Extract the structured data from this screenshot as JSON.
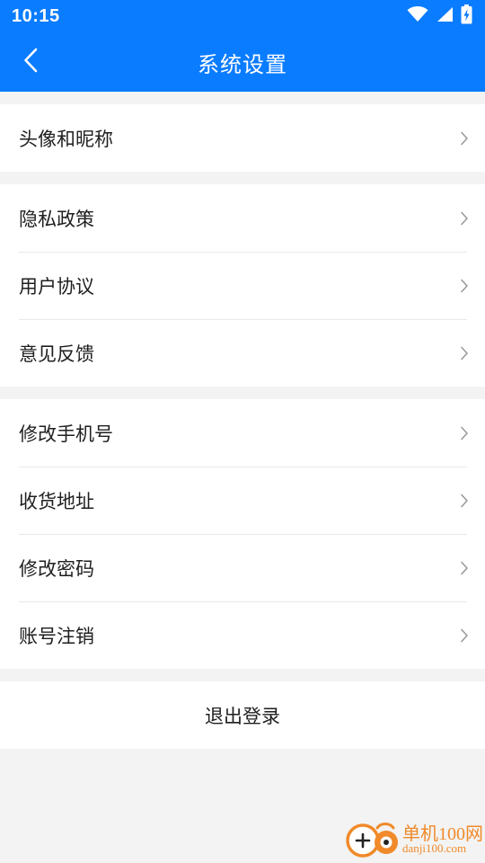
{
  "status_bar": {
    "time": "10:15"
  },
  "header": {
    "title": "系统设置"
  },
  "groups": [
    {
      "items": [
        {
          "label": "头像和昵称"
        }
      ]
    },
    {
      "items": [
        {
          "label": "隐私政策"
        },
        {
          "label": "用户协议"
        },
        {
          "label": "意见反馈"
        }
      ]
    },
    {
      "items": [
        {
          "label": "修改手机号"
        },
        {
          "label": "收货地址"
        },
        {
          "label": "修改密码"
        },
        {
          "label": "账号注销"
        }
      ]
    }
  ],
  "logout": {
    "label": "退出登录"
  },
  "watermark": {
    "site_name": "单机100网",
    "url": "danji100.com"
  },
  "colors": {
    "header_background": "#0a7cff",
    "page_background": "#f3f3f3",
    "chevron": "#9a9a9a",
    "watermark": "#f08a2a"
  },
  "icons": {
    "wifi": "wifi-icon",
    "signal": "signal-icon",
    "battery": "battery-charging-icon",
    "back": "back-arrow-icon",
    "chevron": "chevron-right-icon"
  }
}
